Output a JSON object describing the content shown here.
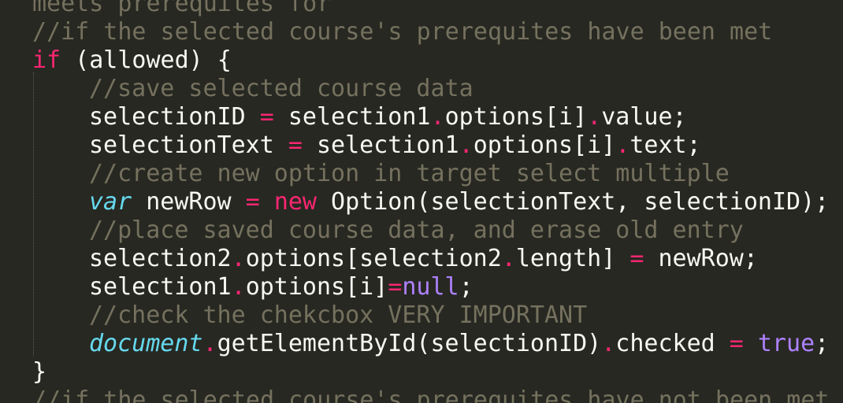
{
  "editor": {
    "colors": {
      "background": "#272822",
      "foreground": "#f8f8f2",
      "comment": "#75715e",
      "keyword": "#f92672",
      "constant": "#ae81ff",
      "storage": "#66d9ef"
    },
    "lines": [
      [
        {
          "t": "comment",
          "v": "meets prerequites for"
        }
      ],
      [
        {
          "t": "comment",
          "v": "//if the selected course's prerequites have been met"
        }
      ],
      [
        {
          "t": "keyword",
          "v": "if"
        },
        {
          "t": "plain",
          "v": " (allowed) {"
        }
      ],
      [
        {
          "t": "indent"
        },
        {
          "t": "comment",
          "v": "//save selected course data"
        }
      ],
      [
        {
          "t": "indent"
        },
        {
          "t": "plain",
          "v": "selectionID "
        },
        {
          "t": "operator",
          "v": "="
        },
        {
          "t": "plain",
          "v": " selection1"
        },
        {
          "t": "operator",
          "v": "."
        },
        {
          "t": "plain",
          "v": "options[i]"
        },
        {
          "t": "operator",
          "v": "."
        },
        {
          "t": "plain",
          "v": "value;"
        }
      ],
      [
        {
          "t": "indent"
        },
        {
          "t": "plain",
          "v": "selectionText "
        },
        {
          "t": "operator",
          "v": "="
        },
        {
          "t": "plain",
          "v": " selection1"
        },
        {
          "t": "operator",
          "v": "."
        },
        {
          "t": "plain",
          "v": "options[i]"
        },
        {
          "t": "operator",
          "v": "."
        },
        {
          "t": "plain",
          "v": "text;"
        }
      ],
      [
        {
          "t": "indent"
        },
        {
          "t": "comment",
          "v": "//create new option in target select multiple"
        }
      ],
      [
        {
          "t": "indent"
        },
        {
          "t": "storage",
          "v": "var"
        },
        {
          "t": "plain",
          "v": " newRow "
        },
        {
          "t": "operator",
          "v": "="
        },
        {
          "t": "plain",
          "v": " "
        },
        {
          "t": "keyword",
          "v": "new"
        },
        {
          "t": "plain",
          "v": " Option(selectionText, selectionID);"
        }
      ],
      [
        {
          "t": "indent"
        },
        {
          "t": "comment",
          "v": "//place saved course data, and erase old entry"
        }
      ],
      [
        {
          "t": "indent"
        },
        {
          "t": "plain",
          "v": "selection2"
        },
        {
          "t": "operator",
          "v": "."
        },
        {
          "t": "plain",
          "v": "options[selection2"
        },
        {
          "t": "operator",
          "v": "."
        },
        {
          "t": "plain",
          "v": "length] "
        },
        {
          "t": "operator",
          "v": "="
        },
        {
          "t": "plain",
          "v": " newRow;"
        }
      ],
      [
        {
          "t": "indent"
        },
        {
          "t": "plain",
          "v": "selection1"
        },
        {
          "t": "operator",
          "v": "."
        },
        {
          "t": "plain",
          "v": "options[i]"
        },
        {
          "t": "operator",
          "v": "="
        },
        {
          "t": "constant",
          "v": "null"
        },
        {
          "t": "plain",
          "v": ";"
        }
      ],
      [
        {
          "t": "indent"
        },
        {
          "t": "comment",
          "v": "//check the chekcbox VERY IMPORTANT"
        }
      ],
      [
        {
          "t": "indent"
        },
        {
          "t": "support",
          "v": "document"
        },
        {
          "t": "operator",
          "v": "."
        },
        {
          "t": "plain",
          "v": "getElementById(selectionID)"
        },
        {
          "t": "operator",
          "v": "."
        },
        {
          "t": "plain",
          "v": "checked "
        },
        {
          "t": "operator",
          "v": "="
        },
        {
          "t": "plain",
          "v": " "
        },
        {
          "t": "constant",
          "v": "true"
        },
        {
          "t": "plain",
          "v": ";"
        }
      ],
      [
        {
          "t": "plain",
          "v": "}"
        }
      ],
      [
        {
          "t": "comment",
          "v": "//if the selected course's prerequites have not been met"
        }
      ]
    ]
  }
}
